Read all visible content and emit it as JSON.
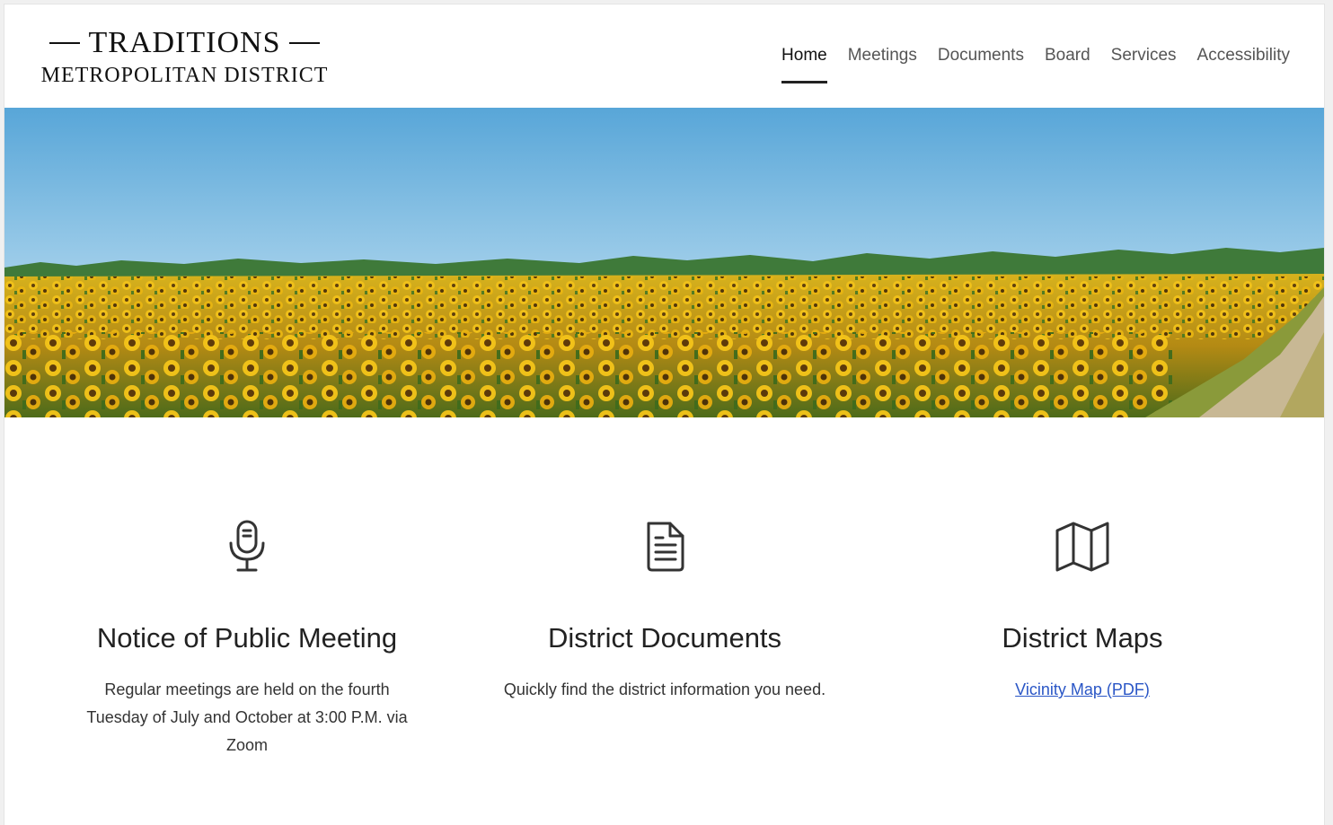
{
  "header": {
    "logo_line1": "TRADITIONS",
    "logo_line2": "METROPOLITAN DISTRICT"
  },
  "nav": {
    "items": [
      {
        "label": "Home",
        "active": true
      },
      {
        "label": "Meetings"
      },
      {
        "label": "Documents"
      },
      {
        "label": "Board"
      },
      {
        "label": "Services"
      },
      {
        "label": "Accessibility"
      }
    ]
  },
  "hero": {
    "image": "sunflower-field-banner"
  },
  "features": [
    {
      "icon": "microphone-icon",
      "title": "Notice of Public Meeting",
      "text": "Regular meetings are held on the fourth Tuesday of July and October at 3:00 P.M. via Zoom"
    },
    {
      "icon": "document-icon",
      "title": "District Documents",
      "text": "Quickly find the district information you need."
    },
    {
      "icon": "map-icon",
      "title": "District Maps",
      "link": "Vicinity Map (PDF)"
    }
  ],
  "colors": {
    "link": "#2a56c6",
    "text": "#333333",
    "heading": "#222222"
  }
}
